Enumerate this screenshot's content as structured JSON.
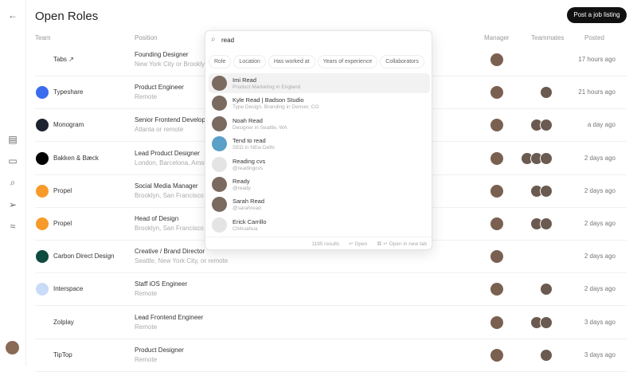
{
  "page": {
    "title": "Open Roles",
    "post_button": "Post a job listing"
  },
  "headers": {
    "team": "Team",
    "position": "Position",
    "manager": "Manager",
    "teammates": "Teammates",
    "posted": "Posted"
  },
  "rows": [
    {
      "team": "Tabs ↗",
      "position": "Founding Designer",
      "location": "New York City or Brooklyn",
      "posted": "17 hours ago",
      "logo_color": "#ffffff",
      "mates": 0
    },
    {
      "team": "Typeshare",
      "position": "Product Engineer",
      "location": "Remote",
      "posted": "21 hours ago",
      "logo_color": "#3b6cf0",
      "mates": 1
    },
    {
      "team": "Monogram",
      "position": "Senior Frontend Developer",
      "location": "Atlanta or remote",
      "posted": "a day ago",
      "logo_color": "#1d2230",
      "mates": 2
    },
    {
      "team": "Bakken & Bæck",
      "position": "Lead Product Designer",
      "location": "London, Barcelona, Amsterdam",
      "posted": "2 days ago",
      "logo_color": "#000000",
      "mates": 3
    },
    {
      "team": "Propel",
      "position": "Social Media Manager",
      "location": "Brooklyn, San Francisco",
      "posted": "2 days ago",
      "logo_color": "#f89a2a",
      "mates": 2
    },
    {
      "team": "Propel",
      "position": "Head of Design",
      "location": "Brooklyn, San Francisco",
      "posted": "2 days ago",
      "logo_color": "#f89a2a",
      "mates": 2
    },
    {
      "team": "Carbon Direct Design",
      "position": "Creative / Brand Director",
      "location": "Seattle, New York City, or remote",
      "posted": "2 days ago",
      "logo_color": "#0f4a3f",
      "mates": 0
    },
    {
      "team": "Interspace",
      "position": "Staff iOS Engineer",
      "location": "Remote",
      "posted": "2 days ago",
      "logo_color": "#c9dcf7",
      "mates": 1
    },
    {
      "team": "Zolplay",
      "position": "Lead Frontend Engineer",
      "location": "Remote",
      "posted": "3 days ago",
      "logo_color": "#ffffff",
      "mates": 2
    },
    {
      "team": "TipTop",
      "position": "Product Designer",
      "location": "Remote",
      "posted": "3 days ago",
      "logo_color": "#ffffff",
      "mates": 1
    }
  ],
  "search": {
    "query": "read",
    "filters": [
      "Role",
      "Location",
      "Has worked at",
      "Years of experience",
      "Collaborators"
    ],
    "results": [
      {
        "name": "Imi Read",
        "sub": "Product Marketing in England"
      },
      {
        "name": "Kyle Read | Badson Studio",
        "sub": "Type Design, Branding in Denver, CO"
      },
      {
        "name": "Noah Read",
        "sub": "Designer in Seattle, WA"
      },
      {
        "name": "Tend to read",
        "sub": "SEO in NEw Delhi"
      },
      {
        "name": "Reading cvs",
        "sub": "@readingcvs"
      },
      {
        "name": "Ready",
        "sub": "@ready"
      },
      {
        "name": "Sarah Read",
        "sub": "@sarahread"
      },
      {
        "name": "Erick Carrillo",
        "sub": "Chihuahua"
      }
    ],
    "count": "1195 results",
    "open": "↵ Open",
    "open_tab": "⌘ ↵ Open in new tab"
  }
}
